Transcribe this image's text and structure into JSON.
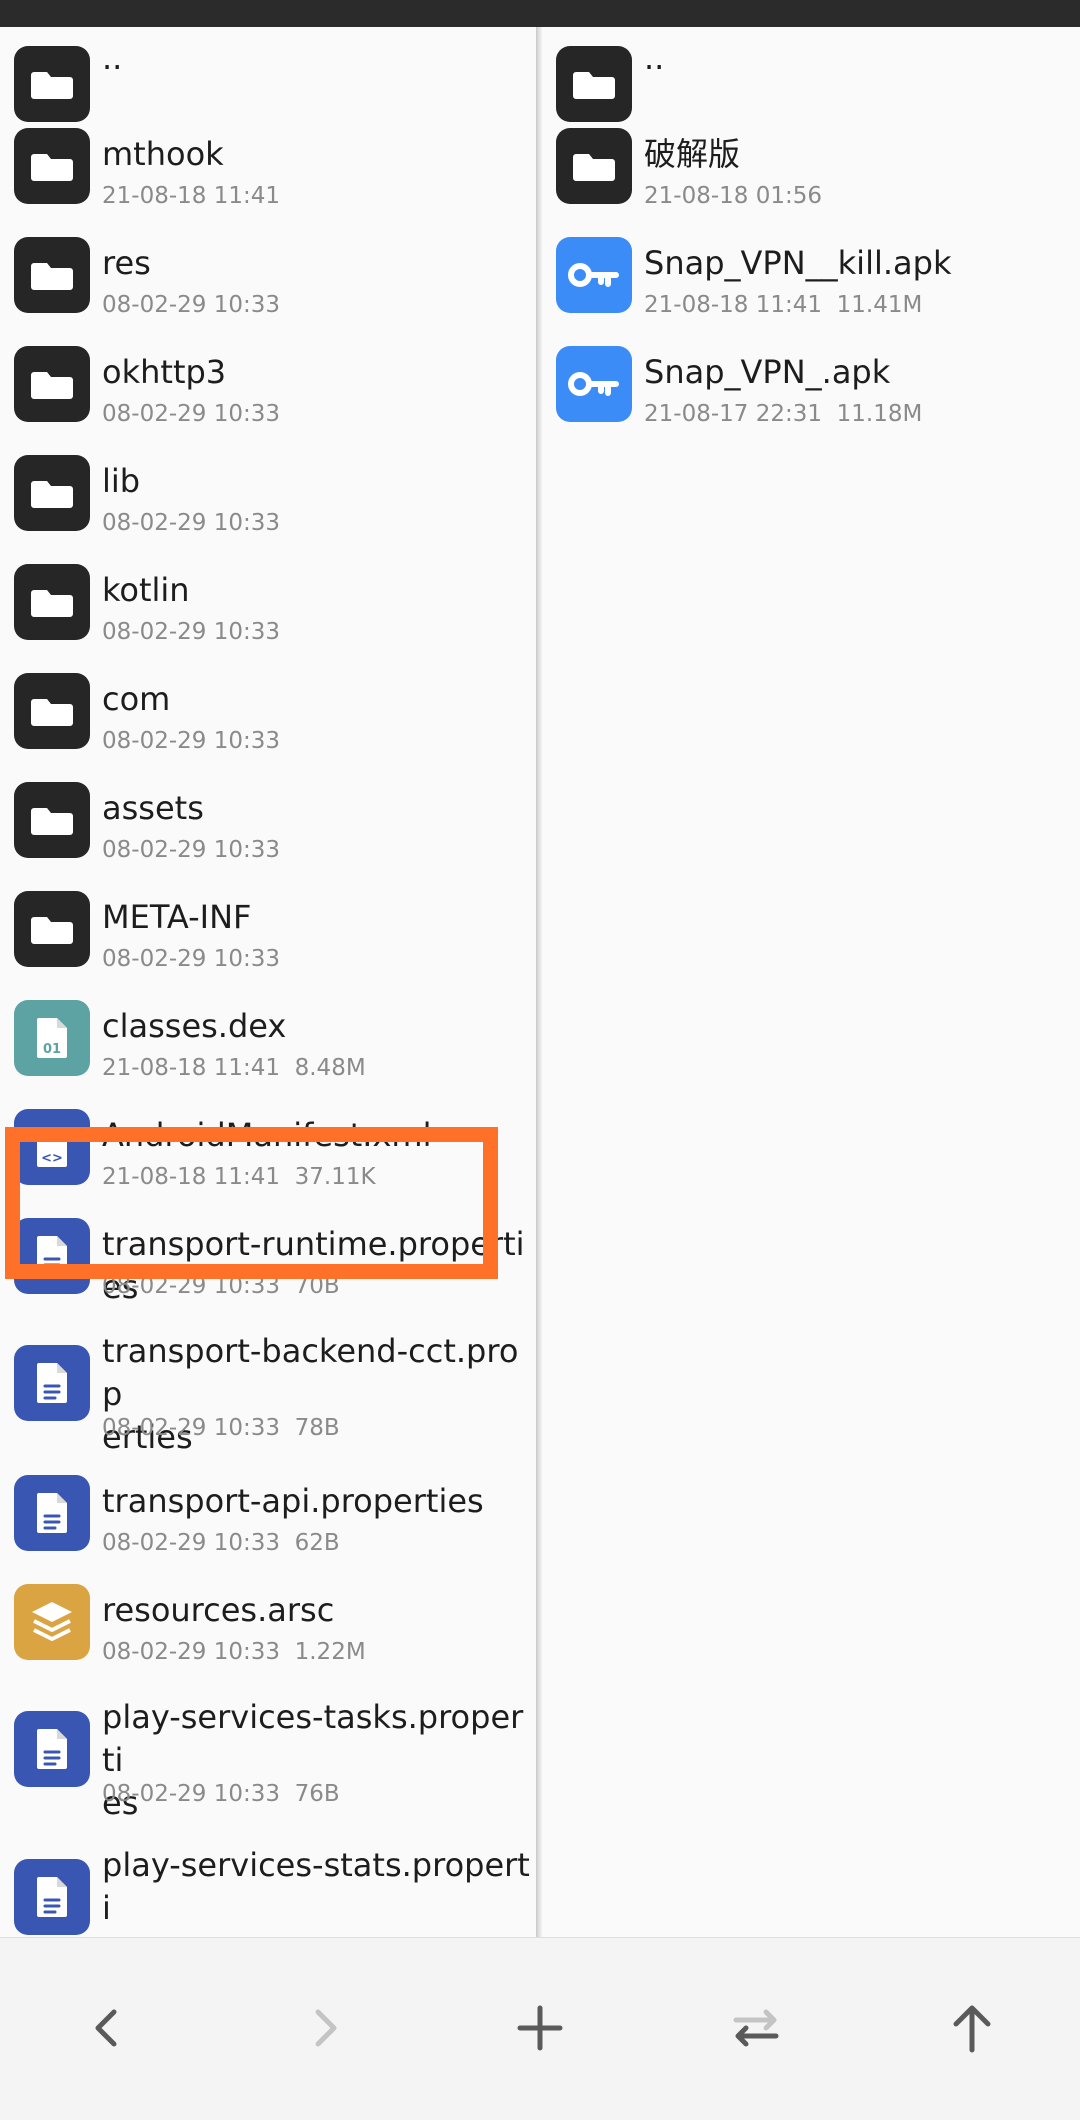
{
  "left_pane": {
    "items": [
      {
        "name": "..",
        "meta": "",
        "type": "folder",
        "icon": "folder-icon"
      },
      {
        "name": "mthook",
        "meta": "21-08-18 11:41",
        "type": "folder",
        "icon": "folder-icon"
      },
      {
        "name": "res",
        "meta": "08-02-29 10:33",
        "type": "folder",
        "icon": "folder-icon"
      },
      {
        "name": "okhttp3",
        "meta": "08-02-29 10:33",
        "type": "folder",
        "icon": "folder-icon"
      },
      {
        "name": "lib",
        "meta": "08-02-29 10:33",
        "type": "folder",
        "icon": "folder-icon"
      },
      {
        "name": "kotlin",
        "meta": "08-02-29 10:33",
        "type": "folder",
        "icon": "folder-icon"
      },
      {
        "name": "com",
        "meta": "08-02-29 10:33",
        "type": "folder",
        "icon": "folder-icon"
      },
      {
        "name": "assets",
        "meta": "08-02-29 10:33",
        "type": "folder",
        "icon": "folder-icon"
      },
      {
        "name": "META-INF",
        "meta": "08-02-29 10:33",
        "type": "folder",
        "icon": "folder-icon"
      },
      {
        "name": "classes.dex",
        "meta": "21-08-18 11:41  8.48M",
        "type": "dex",
        "icon": "binary-file-icon",
        "icon_text": "01"
      },
      {
        "name": "AndroidManifest.xml",
        "meta": "21-08-18 11:41  37.11K",
        "type": "xml",
        "icon": "code-file-icon",
        "icon_text": "<>",
        "highlighted": true
      },
      {
        "name": "transport-runtime.properties",
        "meta": "08-02-29 10:33  70B",
        "type": "doc",
        "icon": "document-icon"
      },
      {
        "name": "transport-backend-cct.prop\nerties",
        "meta": "08-02-29 10:33  78B",
        "type": "doc",
        "icon": "document-icon"
      },
      {
        "name": "transport-api.properties",
        "meta": "08-02-29 10:33  62B",
        "type": "doc",
        "icon": "document-icon"
      },
      {
        "name": "resources.arsc",
        "meta": "08-02-29 10:33  1.22M",
        "type": "arsc",
        "icon": "layers-icon"
      },
      {
        "name": "play-services-tasks.properti\nes",
        "meta": "08-02-29 10:33  76B",
        "type": "doc",
        "icon": "document-icon"
      },
      {
        "name": "play-services-stats.properti\nes",
        "meta": "",
        "type": "doc",
        "icon": "document-icon"
      }
    ]
  },
  "right_pane": {
    "items": [
      {
        "name": "..",
        "meta": "",
        "type": "folder",
        "icon": "folder-icon"
      },
      {
        "name": "破解版",
        "meta": "21-08-18 01:56",
        "type": "folder",
        "icon": "folder-icon"
      },
      {
        "name": "Snap_VPN__kill.apk",
        "meta": "21-08-18 11:41  11.41M",
        "type": "apk",
        "icon": "key-icon"
      },
      {
        "name": "Snap_VPN_.apk",
        "meta": "21-08-17 22:31  11.18M",
        "type": "apk",
        "icon": "key-icon"
      }
    ]
  },
  "toolbar": {
    "buttons": [
      {
        "name": "back-button",
        "icon": "chevron-left-icon",
        "enabled": true
      },
      {
        "name": "forward-button",
        "icon": "chevron-right-icon",
        "enabled": false
      },
      {
        "name": "new-button",
        "icon": "plus-icon",
        "enabled": true
      },
      {
        "name": "swap-panes-button",
        "icon": "swap-arrows-icon",
        "enabled": true
      },
      {
        "name": "parent-directory-button",
        "icon": "arrow-up-icon",
        "enabled": true
      }
    ]
  },
  "colors": {
    "folder": "#262626",
    "apk": "#3b8cf6",
    "dex": "#5ea3a3",
    "xml": "#3957b2",
    "doc": "#3957b2",
    "arsc": "#dba443",
    "highlight": "#ff7128",
    "toolbar_icon": "#5a5a5a",
    "toolbar_icon_disabled": "#c4c4c4"
  }
}
